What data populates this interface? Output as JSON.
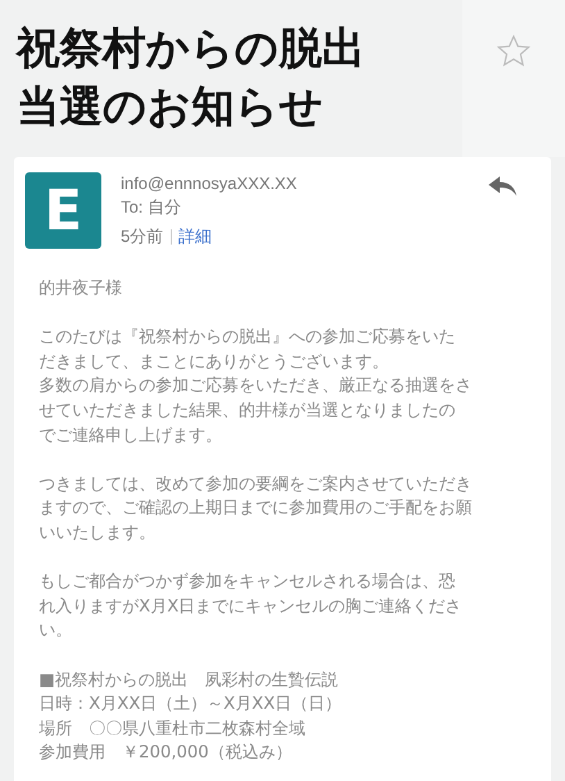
{
  "header": {
    "title_lines": [
      "祝祭村からの脱出",
      "当選のお知らせ"
    ],
    "starred": false
  },
  "message": {
    "avatar_letter": "E",
    "sender": "info@ennnosyaXXX.XX",
    "to": "To: 自分",
    "time": "5分前",
    "details_link": "詳細",
    "body": [
      {
        "kind": "paragraph",
        "lines": [
          "的井夜子様"
        ]
      },
      {
        "kind": "paragraph",
        "lines": [
          "このたびは『祝祭村からの脱出』への参加ご応募をいた",
          "だきまして、まことにありがとうございます。",
          "多数の肩からの参加ご応募をいただき、厳正なる抽選をさ",
          "せていただきました結果、的井様が当選となりましたの",
          "でご連絡申し上げます。"
        ]
      },
      {
        "kind": "paragraph",
        "lines": [
          "つきましては、改めて参加の要綱をご案内させていただき",
          "ますので、ご確認の上期日までに参加費用のご手配をお願",
          "いいたします。"
        ]
      },
      {
        "kind": "paragraph",
        "lines": [
          "もしご都合がつかず参加をキャンセルされる場合は、恐",
          "れ入りますがX月X日までにキャンセルの胸ご連絡くださ",
          "い。"
        ]
      },
      {
        "kind": "details",
        "lines": [
          "■祝祭村からの脱出　夙彩村の生贄伝説",
          "日時：X月XX日（土）～X月XX日（日）",
          "場所　〇〇県八重杜市二枚森村全域",
          "参加費用　￥200,000（税込み）"
        ]
      }
    ]
  }
}
